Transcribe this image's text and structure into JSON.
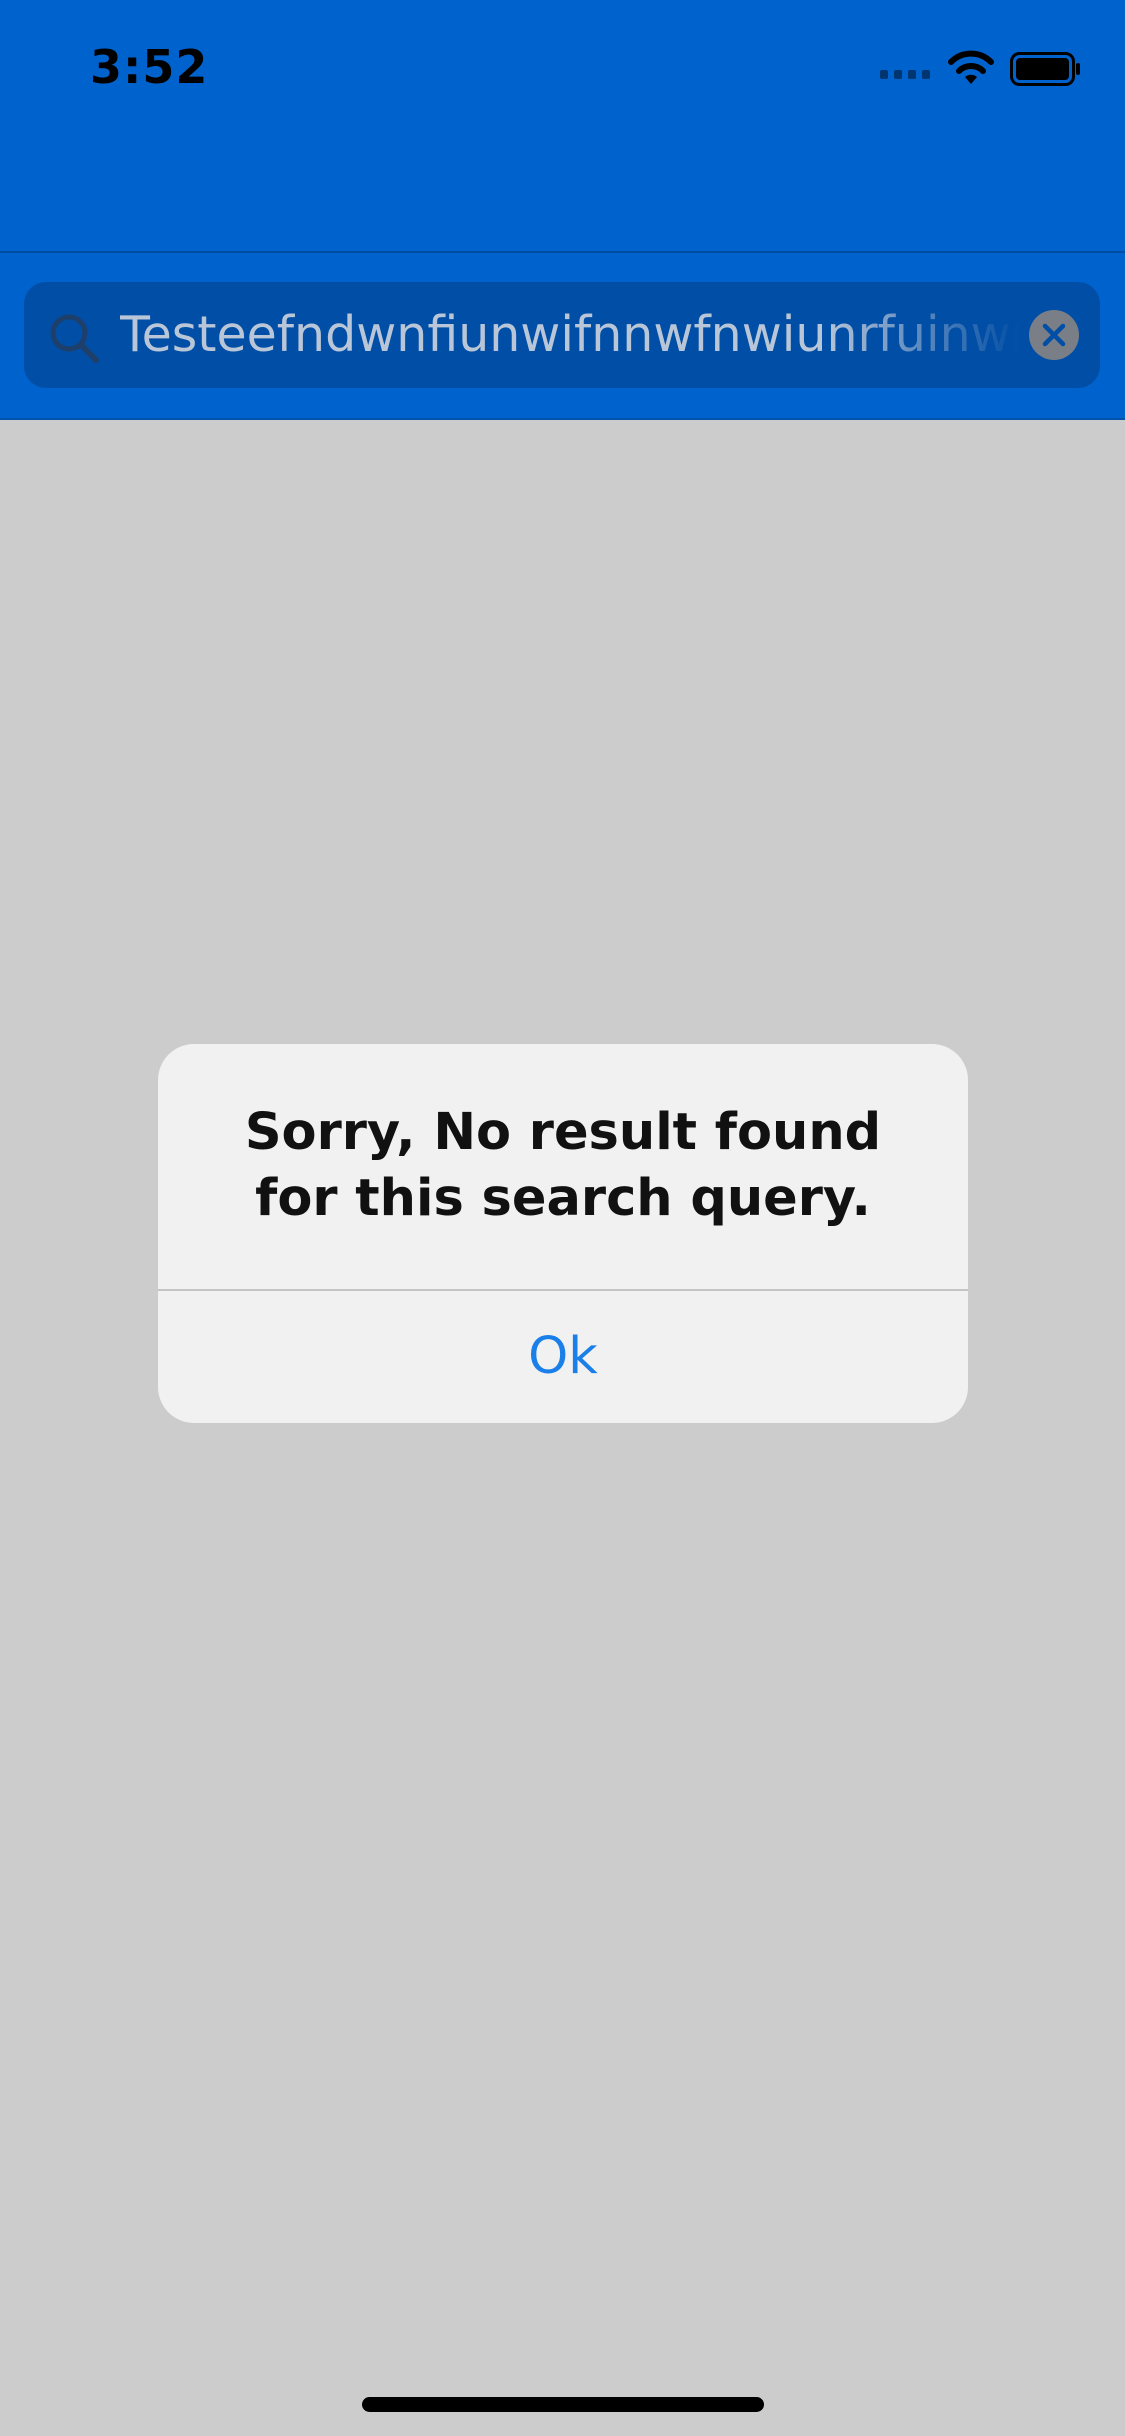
{
  "status_bar": {
    "time": "3:52",
    "icons": [
      "cellular-signal-icon",
      "wifi-icon",
      "battery-icon"
    ]
  },
  "search": {
    "value": "Testeefndwnfiunwifnnwfnwiunrfuinwrfuinwrf",
    "icons": [
      "search-icon",
      "clear-icon"
    ]
  },
  "alert": {
    "message": "Sorry, No result found for this search query.",
    "ok_label": "Ok"
  },
  "colors": {
    "header": "#0062cc",
    "search_field": "#004ea6",
    "backdrop": "#cccccc",
    "dialog": "#f1f1f1",
    "accent": "#1a7fe8"
  }
}
